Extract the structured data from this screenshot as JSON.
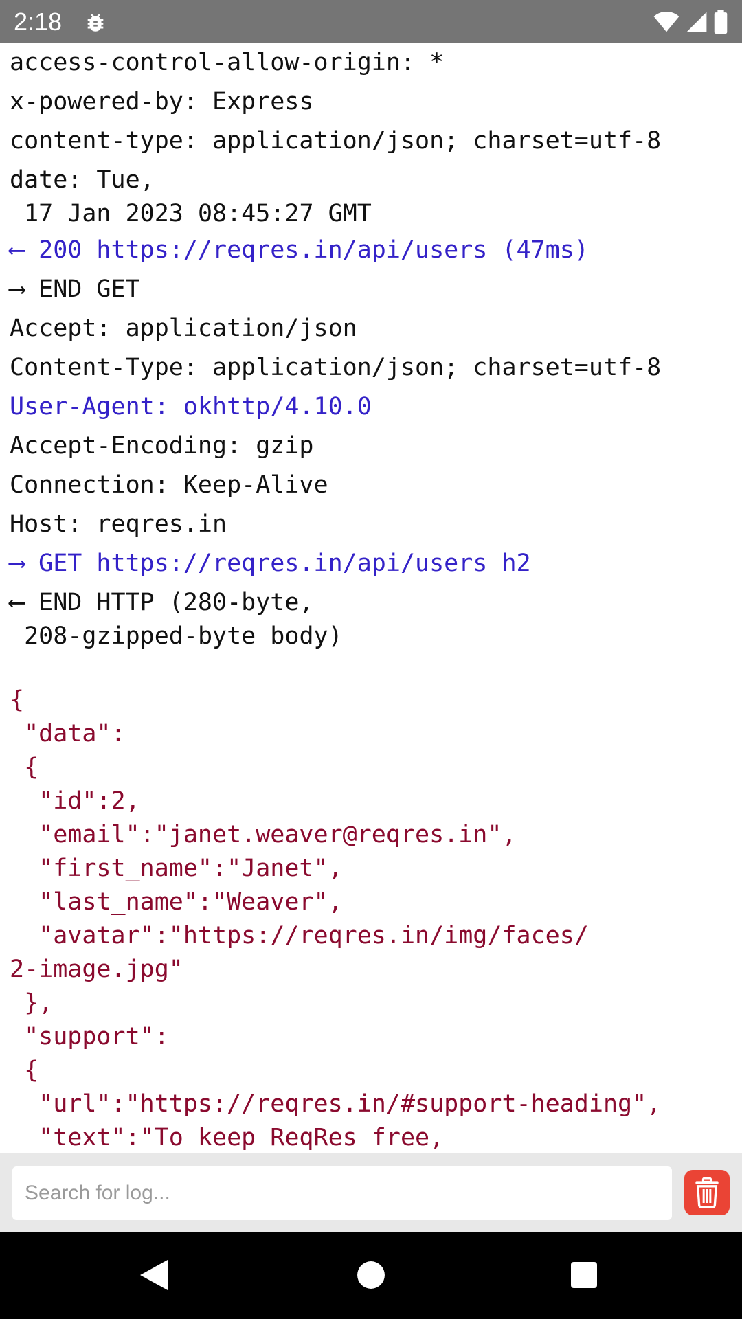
{
  "status_bar": {
    "time": "2:18",
    "icons": [
      "debug-bug-icon",
      "wifi-icon",
      "cellular-signal-icon",
      "battery-icon"
    ]
  },
  "log": {
    "lines": [
      {
        "text": "access-control-allow-origin: *",
        "color": "black"
      },
      {
        "text": "x-powered-by: Express",
        "color": "black"
      },
      {
        "text": "content-type: application/json; charset=utf-8",
        "color": "black"
      },
      {
        "text": "date: Tue,\n 17 Jan 2023 08:45:27 GMT",
        "color": "black"
      },
      {
        "text": "⟵ 200 https://reqres.in/api/users (47ms)",
        "color": "blue"
      },
      {
        "text": "⟶ END GET",
        "color": "black"
      },
      {
        "text": "Accept: application/json",
        "color": "black"
      },
      {
        "text": "Content-Type: application/json; charset=utf-8",
        "color": "black"
      },
      {
        "text": "User-Agent: okhttp/4.10.0",
        "color": "blue"
      },
      {
        "text": "Accept-Encoding: gzip",
        "color": "black"
      },
      {
        "text": "Connection: Keep-Alive",
        "color": "black"
      },
      {
        "text": "Host: reqres.in",
        "color": "black"
      },
      {
        "text": "⟶ GET https://reqres.in/api/users h2",
        "color": "blue"
      },
      {
        "text": "⟵ END HTTP (280-byte,\n 208-gzipped-byte body)",
        "color": "black"
      }
    ],
    "json_body": "{\n \"data\":\n {\n  \"id\":2,\n  \"email\":\"janet.weaver@reqres.in\",\n  \"first_name\":\"Janet\",\n  \"last_name\":\"Weaver\",\n  \"avatar\":\"https://reqres.in/img/faces/\n2-image.jpg\"\n },\n \"support\":\n {\n  \"url\":\"https://reqres.in/#support-heading\",\n  \"text\":\"To keep ReqRes free,"
  },
  "search": {
    "placeholder": "Search for log...",
    "value": ""
  },
  "colors": {
    "status_bar": "#757575",
    "log_text": "#111111",
    "log_blue": "#3422c8",
    "json_text": "#8a0a2e",
    "trash_button": "#ea4435",
    "search_bar_bg": "#e8e8e8",
    "nav_bar": "#000000"
  },
  "nav": {
    "icons": [
      "back-icon",
      "home-icon",
      "recents-icon"
    ]
  }
}
